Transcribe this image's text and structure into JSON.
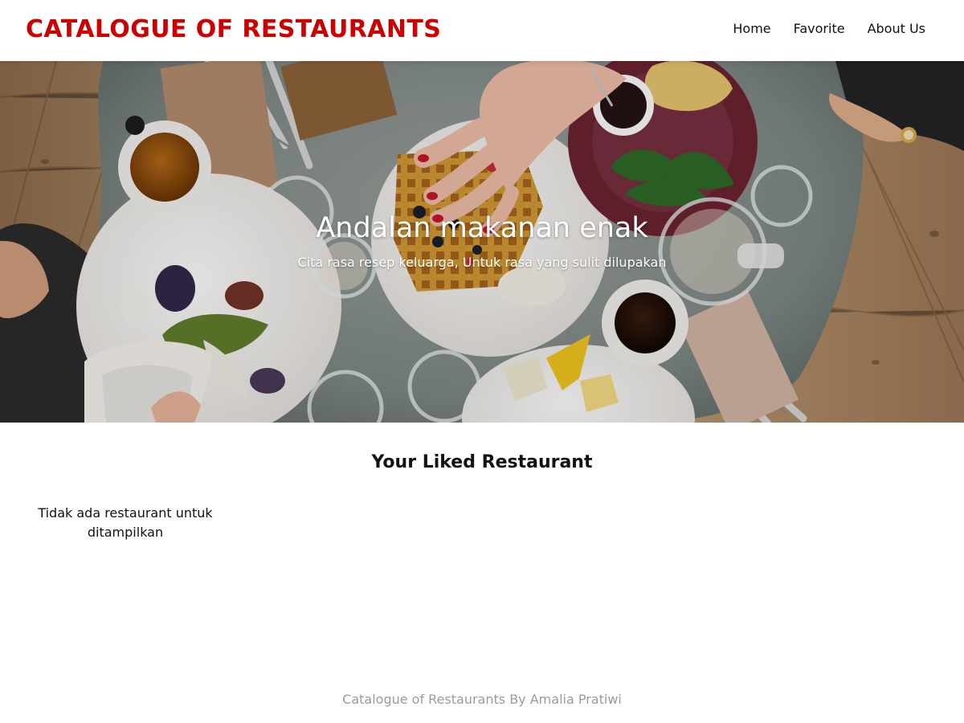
{
  "header": {
    "brand": "CATALOGUE OF RESTAURANTS",
    "nav": [
      "Home",
      "Favorite",
      "About Us"
    ]
  },
  "hero": {
    "title": "Andalan makanan enak",
    "subtitle": "Cita rasa resep keluarga, Untuk rasa yang sulit dilupakan",
    "image_subject": "top view of breakfast table with waffles, coffee, salads, and plates"
  },
  "main": {
    "section_title": "Your Liked Restaurant",
    "empty_message": "Tidak ada restaurant untuk ditampilkan"
  },
  "footer": {
    "text": "Catalogue of Restaurants By Amalia Pratiwi"
  },
  "colors": {
    "brand": "#cc0000",
    "text": "#111111",
    "footer": "#9b9b9b",
    "background": "#ffffff"
  }
}
